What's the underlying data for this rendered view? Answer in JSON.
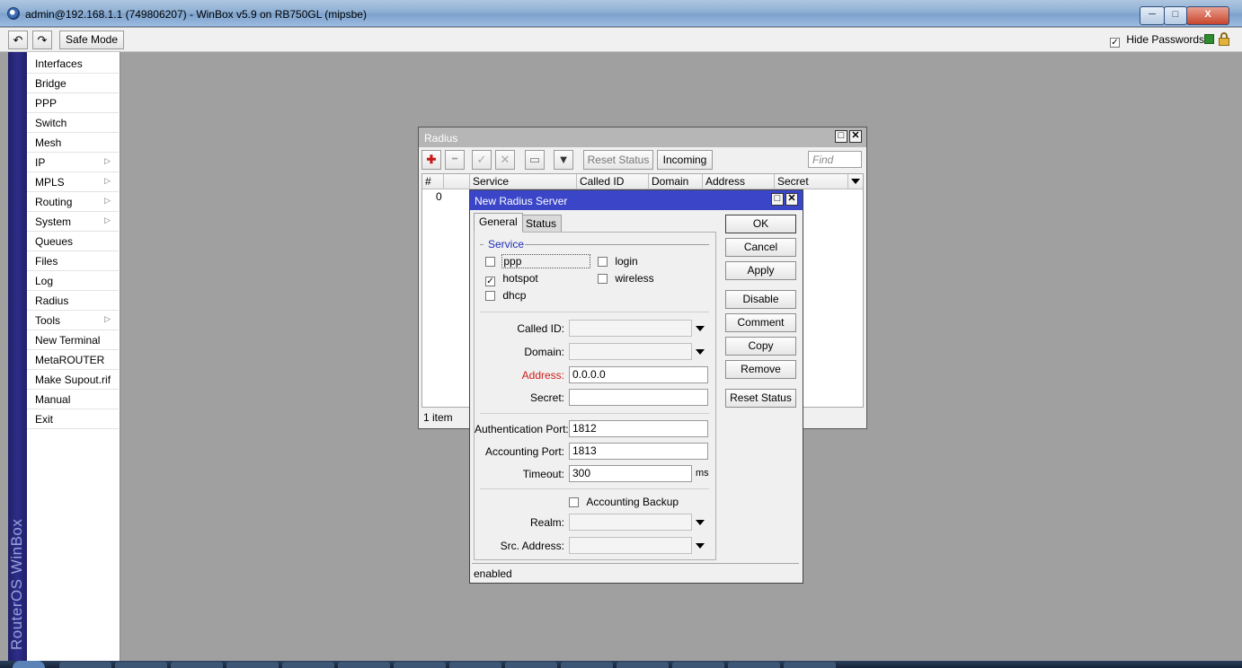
{
  "titlebar": {
    "title": "admin@192.168.1.1 (749806207) - WinBox v5.9 on RB750GL (mipsbe)",
    "minimize_glyph": "─",
    "maximize_glyph": "□",
    "close_glyph": "X"
  },
  "toolbar": {
    "undo_glyph": "↶",
    "redo_glyph": "↷",
    "safe_mode_label": "Safe Mode",
    "hide_passwords_label": "Hide Passwords",
    "hide_passwords_checked": true,
    "status_indicator_color": "#2e8b2e",
    "lock_color": "#d6a21e"
  },
  "sidebar": {
    "brand": "RouterOS WinBox",
    "items": [
      {
        "label": "Interfaces",
        "submenu": false
      },
      {
        "label": "Bridge",
        "submenu": false
      },
      {
        "label": "PPP",
        "submenu": false
      },
      {
        "label": "Switch",
        "submenu": false
      },
      {
        "label": "Mesh",
        "submenu": false
      },
      {
        "label": "IP",
        "submenu": true
      },
      {
        "label": "MPLS",
        "submenu": true
      },
      {
        "label": "Routing",
        "submenu": true
      },
      {
        "label": "System",
        "submenu": true
      },
      {
        "label": "Queues",
        "submenu": false
      },
      {
        "label": "Files",
        "submenu": false
      },
      {
        "label": "Log",
        "submenu": false
      },
      {
        "label": "Radius",
        "submenu": false
      },
      {
        "label": "Tools",
        "submenu": true
      },
      {
        "label": "New Terminal",
        "submenu": false
      },
      {
        "label": "MetaROUTER",
        "submenu": false
      },
      {
        "label": "Make Supout.rif",
        "submenu": false
      },
      {
        "label": "Manual",
        "submenu": false
      },
      {
        "label": "Exit",
        "submenu": false
      }
    ],
    "submenu_glyph": "▷"
  },
  "radius_window": {
    "title": "Radius",
    "add_glyph": "✚",
    "remove_glyph": "━",
    "enable_glyph": "✓",
    "disable_glyph": "✕",
    "comment_glyph": "▭",
    "filter_glyph": "▼",
    "reset_status_label": "Reset Status",
    "incoming_label": "Incoming",
    "find_placeholder": "Find",
    "columns": [
      "#",
      "",
      "Service",
      "Called ID",
      "Domain",
      "Address",
      "Secret"
    ],
    "rows": [
      {
        "num": "0"
      }
    ],
    "status": "1 item"
  },
  "dialog": {
    "title": "New Radius Server",
    "tabs": {
      "general": "General",
      "status": "Status"
    },
    "service_group_label": "Service",
    "services": {
      "ppp": {
        "label": "ppp",
        "checked": false
      },
      "login": {
        "label": "login",
        "checked": false
      },
      "hotspot": {
        "label": "hotspot",
        "checked": true
      },
      "wireless": {
        "label": "wireless",
        "checked": false
      },
      "dhcp": {
        "label": "dhcp",
        "checked": false
      }
    },
    "fields": {
      "called_id_label": "Called ID:",
      "called_id_value": "",
      "domain_label": "Domain:",
      "domain_value": "",
      "address_label": "Address:",
      "address_value": "0.0.0.0",
      "address_label_color": "#d01c1c",
      "secret_label": "Secret:",
      "secret_value": "",
      "auth_port_label": "Authentication Port:",
      "auth_port_value": "1812",
      "acct_port_label": "Accounting Port:",
      "acct_port_value": "1813",
      "timeout_label": "Timeout:",
      "timeout_value": "300",
      "timeout_unit": "ms",
      "accounting_backup_label": "Accounting Backup",
      "accounting_backup_checked": false,
      "realm_label": "Realm:",
      "realm_value": "",
      "src_address_label": "Src. Address:",
      "src_address_value": ""
    },
    "buttons": {
      "ok": "OK",
      "cancel": "Cancel",
      "apply": "Apply",
      "disable": "Disable",
      "comment": "Comment",
      "copy": "Copy",
      "remove": "Remove",
      "reset_status": "Reset Status"
    },
    "status": "enabled"
  }
}
